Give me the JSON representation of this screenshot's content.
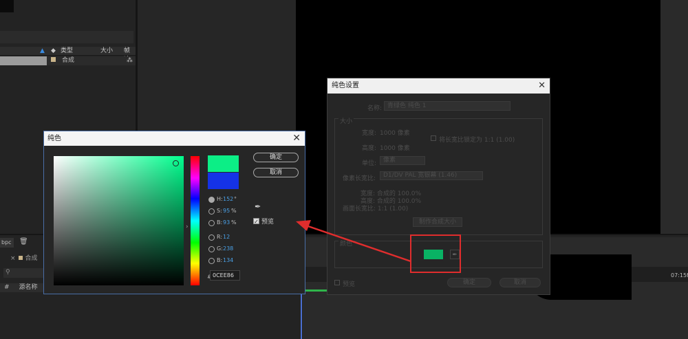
{
  "project": {
    "header": {
      "type_label": "类型",
      "size_label": "大小",
      "fps_label": "帧速"
    },
    "row": {
      "type_value": "合成"
    }
  },
  "timeline": {
    "tab_label": "bpc",
    "comp_tab": "合成",
    "col_name": "源名称",
    "col_hash": "#",
    "time_label": "07:15f"
  },
  "solid_dialog": {
    "title": "纯色设置",
    "name_label": "名称:",
    "name_value": "青绿色 纯色 1",
    "size_group": "大小",
    "width_label": "宽度:",
    "width_value": "1000 像素",
    "height_label": "高度:",
    "height_value": "1000 像素",
    "lock_label": "将长宽比锁定为 1:1 (1.00)",
    "unit_label": "单位:",
    "unit_value": "像素",
    "par_label": "像素长宽比:",
    "par_value": "D1/DV PAL 宽银幕 (1.46)",
    "comp_w": "宽度: 合成的 100.0%",
    "comp_h": "高度: 合成的 100.0%",
    "frame_ratio": "画面长宽比: 1:1 (1.00)",
    "make_comp_btn": "制作合成大小",
    "color_group": "颜色",
    "preview_label": "预览",
    "ok_btn": "确定",
    "cancel_btn": "取消"
  },
  "picker": {
    "title": "纯色",
    "ok_btn": "确定",
    "cancel_btn": "取消",
    "new_color": "#0cee86",
    "old_color": "#1532e6",
    "h_label": "H:",
    "h_value": "152",
    "h_unit": "°",
    "s_label": "S:",
    "s_value": "95",
    "s_unit": "%",
    "b_label": "B:",
    "b_value": "93",
    "b_unit": "%",
    "r_label": "R:",
    "r_value": "12",
    "g_label": "G:",
    "g_value": "238",
    "bl_label": "B:",
    "bl_value": "134",
    "hex_symbol": "#",
    "hex_value": "0CEE86",
    "preview_label": "预览"
  }
}
